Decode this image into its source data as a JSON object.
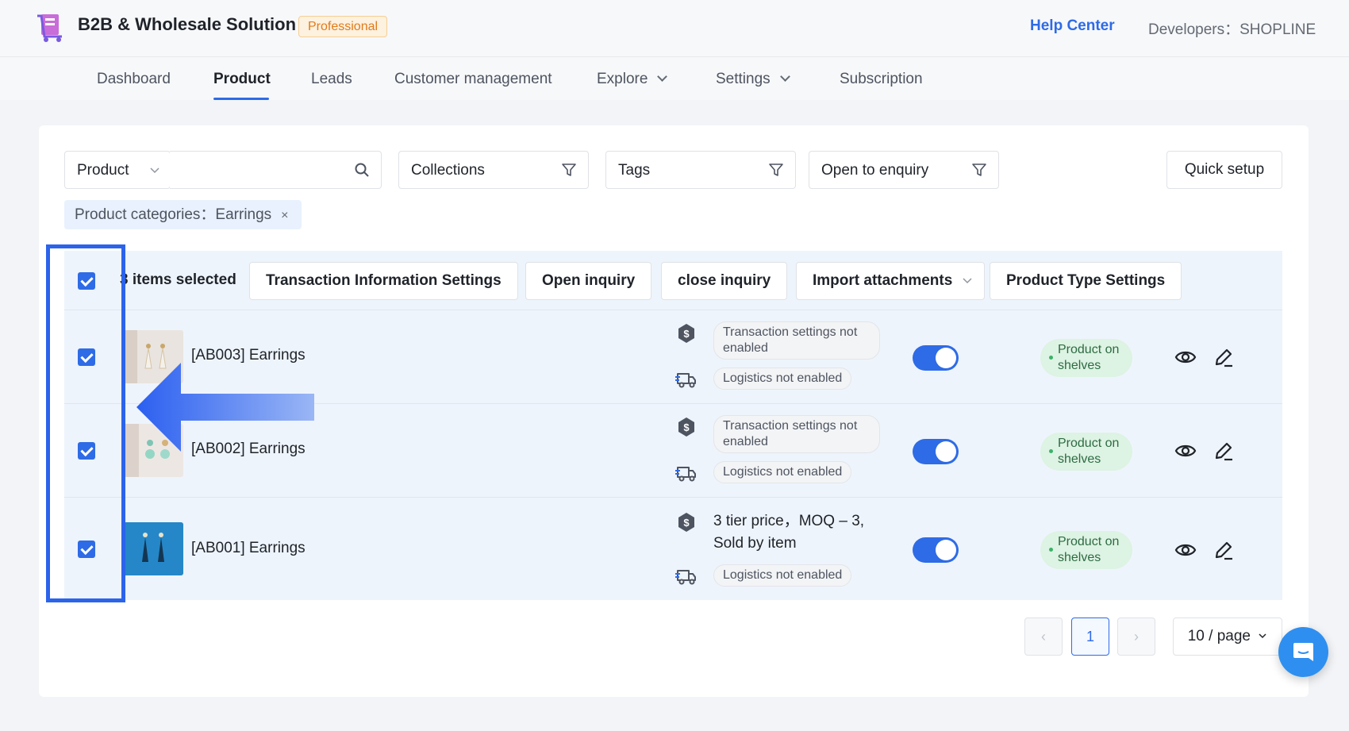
{
  "header": {
    "app_title": "B2B & Wholesale Solution",
    "badge": "Professional",
    "help_center": "Help Center",
    "developers": "Developers：SHOPLINE"
  },
  "nav": {
    "items": [
      {
        "label": "Dashboard"
      },
      {
        "label": "Product"
      },
      {
        "label": "Leads"
      },
      {
        "label": "Customer management"
      },
      {
        "label": "Explore"
      },
      {
        "label": "Settings"
      },
      {
        "label": "Subscription"
      }
    ],
    "active": "Product"
  },
  "filters": {
    "product_select": "Product",
    "search_value": "",
    "collections": "Collections",
    "tags": "Tags",
    "open_to_enquiry": "Open to enquiry",
    "quick_setup": "Quick setup",
    "active_chip": {
      "label": "Product categories：",
      "value": "Earrings",
      "close": "×"
    }
  },
  "bulk": {
    "selected_text": "3 items selected",
    "buttons": [
      {
        "label": "Transaction Information Settings"
      },
      {
        "label": "Open inquiry"
      },
      {
        "label": "close inquiry"
      },
      {
        "label": "Import attachments"
      },
      {
        "label": "Product Type Settings"
      }
    ]
  },
  "rows": [
    {
      "name": "[AB003] Earrings",
      "transaction": "Transaction settings not enabled",
      "logistics": "Logistics not enabled",
      "status": "Product on shelves",
      "selected": true,
      "enabled": true
    },
    {
      "name": "[AB002] Earrings",
      "transaction": "Transaction settings not enabled",
      "logistics": "Logistics not enabled",
      "status": "Product on shelves",
      "selected": true,
      "enabled": true
    },
    {
      "name": "[AB001] Earrings",
      "transaction_line1": "3 tier price，MOQ – 3,",
      "transaction_line2": "Sold by item",
      "logistics": "Logistics not enabled",
      "status": "Product on shelves",
      "selected": true,
      "enabled": true
    }
  ],
  "pagination": {
    "prev": "‹",
    "current": "1",
    "next": "›",
    "page_size": "10 / page"
  },
  "colors": {
    "accent": "#2e6be6",
    "selection_highlight": "#2b63eb",
    "status_green": "#ddf3e3"
  }
}
